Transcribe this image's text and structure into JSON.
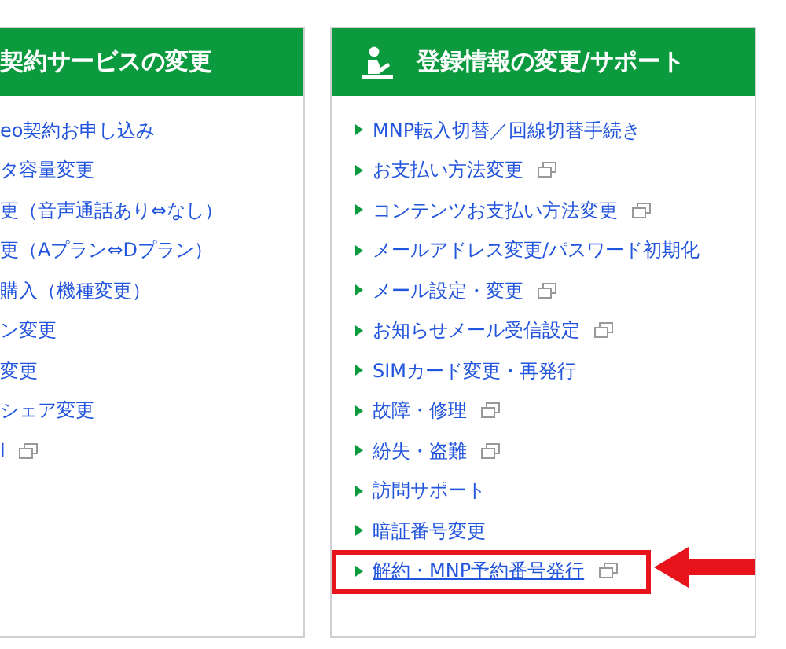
{
  "panels": [
    {
      "title": "契約サービスの変更",
      "has_icon": false,
      "items": [
        {
          "label": "eo契約お申し込み",
          "external": false,
          "bullet": false,
          "highlighted": false
        },
        {
          "label": "タ容量変更",
          "external": false,
          "bullet": false,
          "highlighted": false
        },
        {
          "label": "更（音声通話あり⇔なし）",
          "external": false,
          "bullet": false,
          "highlighted": false
        },
        {
          "label": "更（Aプラン⇔Dプラン）",
          "external": false,
          "bullet": false,
          "highlighted": false
        },
        {
          "label": "購入（機種変更）",
          "external": false,
          "bullet": false,
          "highlighted": false
        },
        {
          "label": "ン変更",
          "external": false,
          "bullet": false,
          "highlighted": false
        },
        {
          "label": "変更",
          "external": false,
          "bullet": false,
          "highlighted": false
        },
        {
          "label": "シェア変更",
          "external": false,
          "bullet": false,
          "highlighted": false
        },
        {
          "label": "l",
          "external": true,
          "bullet": false,
          "highlighted": false
        }
      ]
    },
    {
      "title": "登録情報の変更/サポート",
      "has_icon": true,
      "items": [
        {
          "label": "MNP転入切替／回線切替手続き",
          "external": false,
          "bullet": true,
          "highlighted": false
        },
        {
          "label": "お支払い方法変更",
          "external": true,
          "bullet": true,
          "highlighted": false
        },
        {
          "label": "コンテンツお支払い方法変更",
          "external": true,
          "bullet": true,
          "highlighted": false
        },
        {
          "label": "メールアドレス変更/パスワード初期化",
          "external": false,
          "bullet": true,
          "highlighted": false
        },
        {
          "label": "メール設定・変更",
          "external": true,
          "bullet": true,
          "highlighted": false
        },
        {
          "label": "お知らせメール受信設定",
          "external": true,
          "bullet": true,
          "highlighted": false
        },
        {
          "label": "SIMカード変更・再発行",
          "external": false,
          "bullet": true,
          "highlighted": false
        },
        {
          "label": "故障・修理",
          "external": true,
          "bullet": true,
          "highlighted": false
        },
        {
          "label": "紛失・盗難",
          "external": true,
          "bullet": true,
          "highlighted": false
        },
        {
          "label": "訪問サポート",
          "external": false,
          "bullet": true,
          "highlighted": false
        },
        {
          "label": "暗証番号変更",
          "external": false,
          "bullet": true,
          "highlighted": false
        },
        {
          "label": "解約・MNP予約番号発行",
          "external": true,
          "bullet": true,
          "highlighted": true
        }
      ]
    }
  ]
}
